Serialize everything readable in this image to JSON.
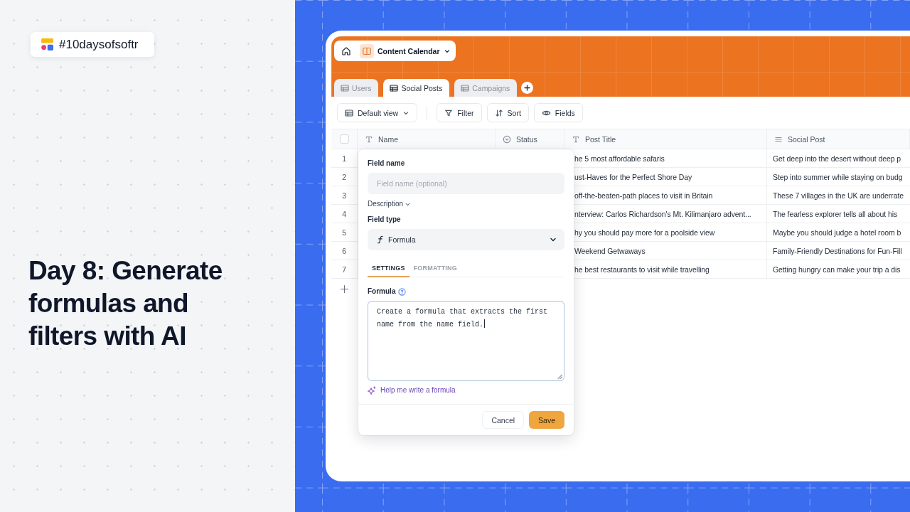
{
  "promo": {
    "hashtag": "#10daysofsoftr",
    "headline": "Day 8: Generate formulas and filters with AI"
  },
  "app": {
    "base": {
      "title": "Content Calendar"
    },
    "tabs": [
      {
        "label": "Users",
        "selected": false
      },
      {
        "label": "Social Posts",
        "selected": true
      },
      {
        "label": "Campaigns",
        "selected": false
      }
    ],
    "toolbar": {
      "view": "Default view",
      "buttons": [
        {
          "label": "Filter",
          "kind": "filter"
        },
        {
          "label": "Sort",
          "kind": "sort"
        },
        {
          "label": "Fields",
          "kind": "fields"
        }
      ]
    },
    "table": {
      "select_all": {
        "checked": false
      },
      "columns": [
        {
          "label": "Name",
          "kind": "text"
        },
        {
          "label": "Status",
          "kind": "select"
        },
        {
          "label": "Post Title",
          "kind": "text"
        },
        {
          "label": "Social Post",
          "kind": "long_text"
        }
      ],
      "rows": [
        {
          "number": "1",
          "post_title": "he 5 most affordable safaris",
          "social_post": "Get deep into the desert without deep p"
        },
        {
          "number": "2",
          "post_title": "ust-Haves for the Perfect Shore Day",
          "social_post": "Step into summer while staying on budg"
        },
        {
          "number": "3",
          "post_title": "off-the-beaten-path places to visit in Britain",
          "social_post": "These 7 villages in the UK are underrate"
        },
        {
          "number": "4",
          "post_title": "nterview: Carlos Richardson's Mt. Kilimanjaro advent...",
          "social_post": "The fearless explorer tells all about his"
        },
        {
          "number": "5",
          "post_title": "hy you should pay more for a poolside view",
          "social_post": "Maybe you should judge a hotel room b"
        },
        {
          "number": "6",
          "post_title": "Weekend Getwaways",
          "social_post": "Family-Friendly Destinations for Fun-Fill"
        },
        {
          "number": "7",
          "post_title": "he best restaurants to visit while travelling",
          "social_post": "Getting hungry can make your trip a dis"
        }
      ]
    }
  },
  "field_editor": {
    "name_field": {
      "label": "Field name",
      "placeholder": "Field name (optional)"
    },
    "description": {
      "label": "Description",
      "expanded": false
    },
    "type_field": {
      "label": "Field type",
      "value": "Formula"
    },
    "tabs": [
      {
        "label": "SETTINGS",
        "selected": true
      },
      {
        "label": "FORMATTING",
        "selected": false
      }
    ],
    "formula": {
      "label": "Formula",
      "value": "Create a formula that extracts the first name from the name field.",
      "focused": true
    },
    "ai_link": "Help me write a formula",
    "buttons": [
      {
        "label": "Cancel",
        "kind": "secondary"
      },
      {
        "label": "Save",
        "kind": "primary"
      }
    ]
  }
}
